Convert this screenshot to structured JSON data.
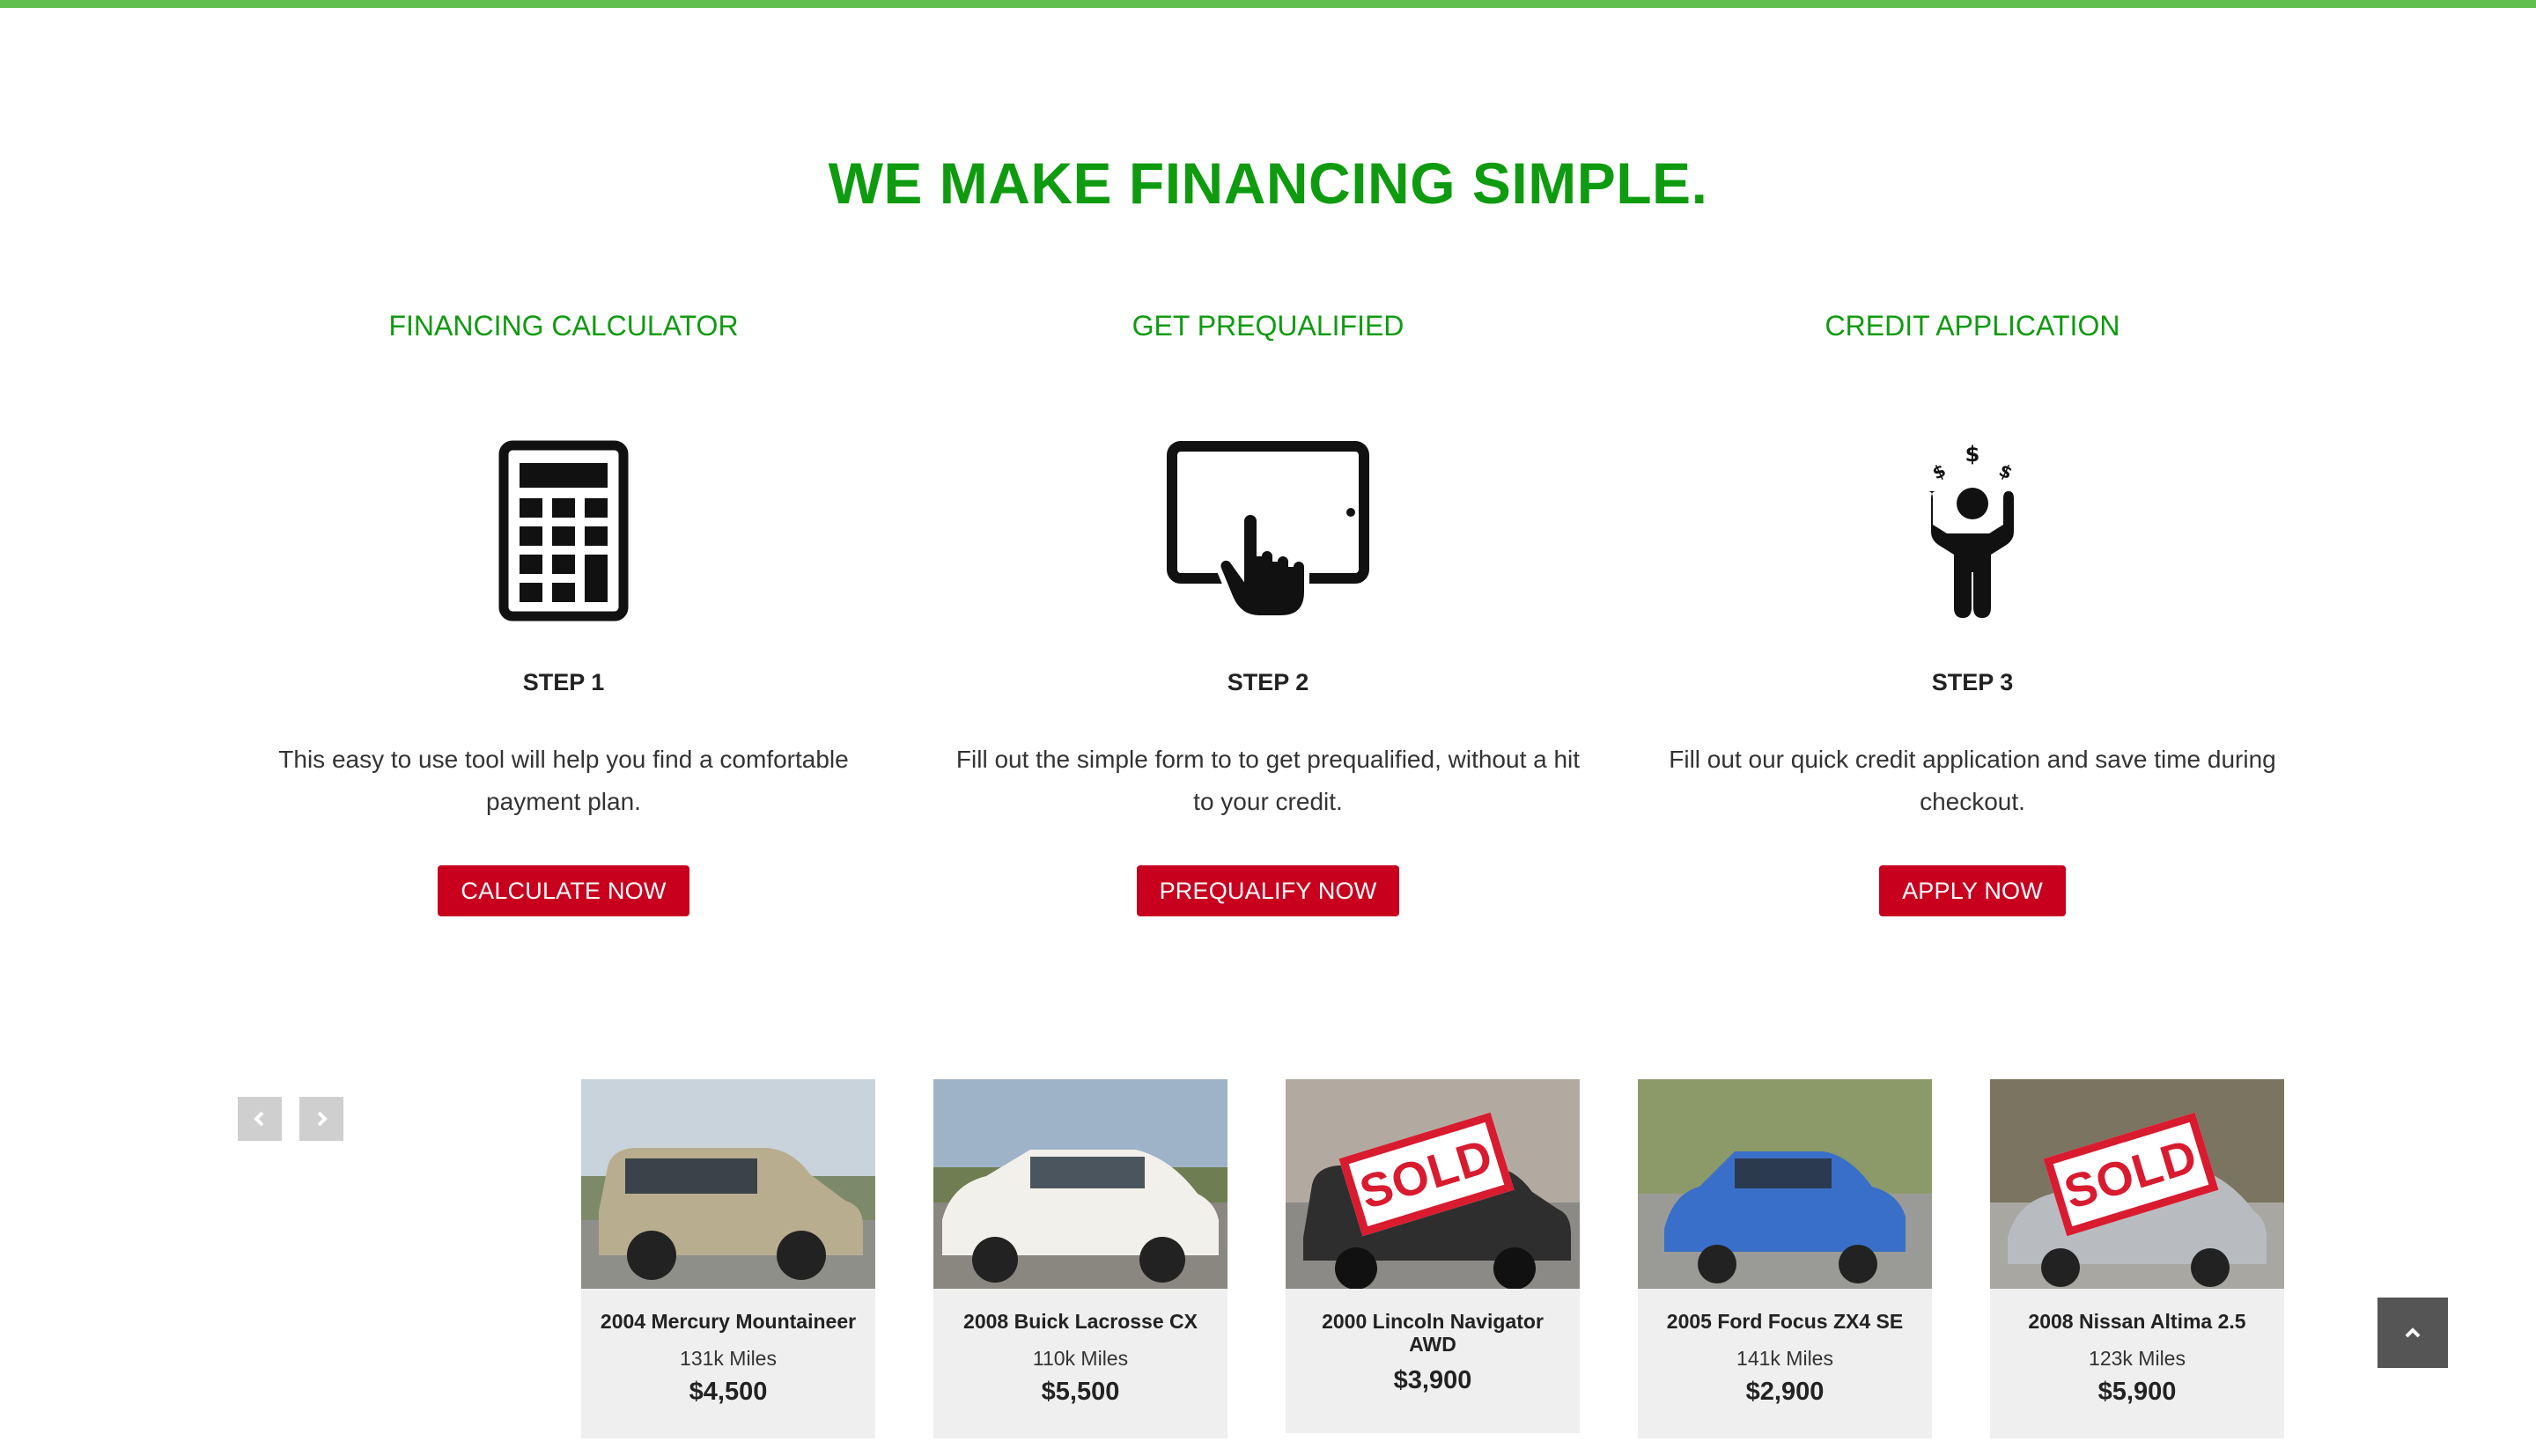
{
  "colors": {
    "accent_green": "#0f9b0f",
    "bar_green": "#5fbf4f",
    "button_red": "#c8001e",
    "sold_red": "#d91b2f"
  },
  "headline": "WE MAKE FINANCING SIMPLE.",
  "steps": [
    {
      "heading": "FINANCING CALCULATOR",
      "icon": "calculator-icon",
      "step_label": "STEP 1",
      "description": "This easy to use tool will help you find a comfortable payment plan.",
      "button": "CALCULATE NOW"
    },
    {
      "heading": "GET PREQUALIFIED",
      "icon": "tablet-touch-icon",
      "step_label": "STEP 2",
      "description": "Fill out the simple form to to get prequalified, without a hit to your credit.",
      "button": "PREQUALIFY NOW"
    },
    {
      "heading": "CREDIT APPLICATION",
      "icon": "person-money-icon",
      "step_label": "STEP 3",
      "description": "Fill out our quick credit application and save time during checkout.",
      "button": "APPLY NOW"
    }
  ],
  "carousel": {
    "prev_icon": "chevron-left-icon",
    "next_icon": "chevron-right-icon",
    "cars": [
      {
        "title": "2004 Mercury Mountaineer",
        "miles": "131k Miles",
        "price": "$4,500",
        "sold": false,
        "body_color": "#b9ad8f"
      },
      {
        "title": "2008 Buick Lacrosse CX",
        "miles": "110k Miles",
        "price": "$5,500",
        "sold": false,
        "body_color": "#f2f0ea"
      },
      {
        "title": "2000 Lincoln Navigator AWD",
        "miles": "",
        "price": "$3,900",
        "sold": true,
        "sold_label": "SOLD",
        "body_color": "#2e2e2e"
      },
      {
        "title": "2005 Ford Focus ZX4 SE",
        "miles": "141k Miles",
        "price": "$2,900",
        "sold": false,
        "body_color": "#3a6fc9"
      },
      {
        "title": "2008 Nissan Altima 2.5",
        "miles": "123k Miles",
        "price": "$5,900",
        "sold": true,
        "sold_label": "SOLD",
        "body_color": "#b8bcc0"
      }
    ]
  },
  "scroll_top_icon": "chevron-up-icon"
}
